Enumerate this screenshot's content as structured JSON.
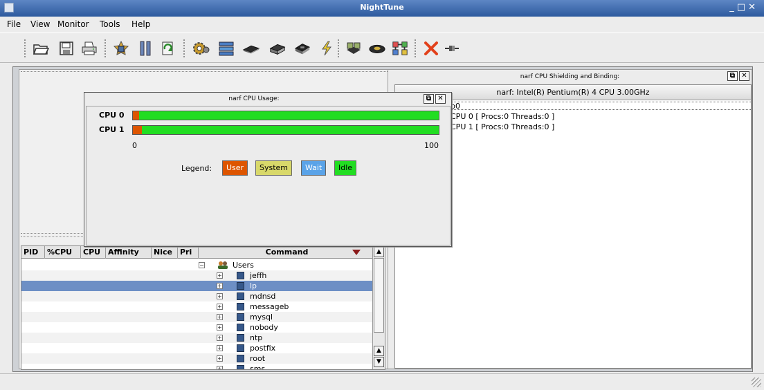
{
  "window": {
    "title": "NightTune"
  },
  "menu": [
    "File",
    "View",
    "Monitor",
    "Tools",
    "Help"
  ],
  "toolbar": {
    "icons": [
      "open-folder-icon",
      "save-disk-icon",
      "print-icon",
      "process-icon",
      "pause-icon",
      "refresh-icon",
      "gear-icon",
      "network-icon",
      "memory-chip-icon",
      "disk-icon",
      "cpu-icon",
      "interrupt-icon",
      "cpu-shield-icon",
      "device-icon",
      "bind-icon",
      "close-x-icon",
      "connect-icon"
    ]
  },
  "colors": {
    "user": "#dd5500",
    "system": "#d8d86a",
    "wait": "#5aa3e8",
    "idle": "#22dd22"
  },
  "cpu_usage": {
    "title": "narf CPU Usage:",
    "cpus": [
      {
        "label": "CPU 0",
        "user": 2,
        "system": 0,
        "wait": 0,
        "idle": 98
      },
      {
        "label": "CPU 1",
        "user": 3,
        "system": 0,
        "wait": 0,
        "idle": 97
      }
    ],
    "axis_min": "0",
    "axis_max": "100",
    "legend_label": "Legend:",
    "legend": [
      "User",
      "System",
      "Wait",
      "Idle"
    ]
  },
  "shielding": {
    "title": "narf CPU Shielding and Binding:",
    "header": "narf:  Intel(R) Pentium(R) 4 CPU 3.00GHz",
    "lines": [
      "p0",
      "CPU 0  [ Procs:0 Threads:0 ]",
      "CPU 1  [ Procs:0 Threads:0 ]"
    ]
  },
  "process_table": {
    "columns": [
      "PID",
      "%CPU",
      "CPU",
      "Affinity",
      "Nice",
      "Pri",
      "Command"
    ],
    "tree_root": "Users",
    "rows": [
      "jeffh",
      "lp",
      "mdnsd",
      "messageb",
      "mysql",
      "nobody",
      "ntp",
      "postfix",
      "root",
      "sms"
    ],
    "selected": "lp"
  }
}
